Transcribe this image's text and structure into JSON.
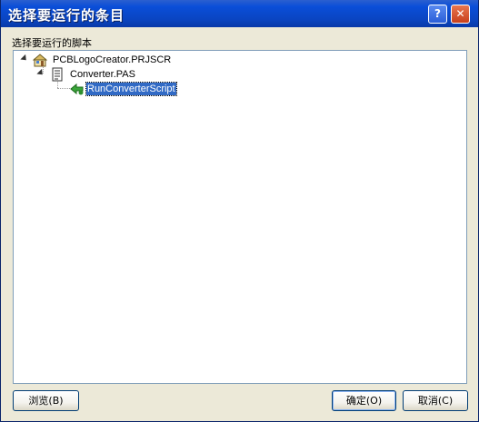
{
  "window": {
    "title": "选择要运行的条目",
    "help_button": "?",
    "close_button": "✕"
  },
  "section_label": "选择要运行的脚本",
  "tree": {
    "items": [
      {
        "label": "PCBLogoCreator.PRJSCR",
        "icon": "project-icon",
        "level": 0,
        "expanded": true
      },
      {
        "label": "Converter.PAS",
        "icon": "script-file-icon",
        "level": 1,
        "expanded": true
      },
      {
        "label": "RunConverterScript",
        "icon": "procedure-icon",
        "level": 2,
        "selected": true
      }
    ]
  },
  "buttons": {
    "browse": "浏览(B)",
    "ok": "确定(O)",
    "cancel": "取消(C)"
  },
  "colors": {
    "titlebar": "#0a45c2",
    "selection": "#316ac5",
    "dialog_bg": "#ece9d8",
    "tree_border": "#7f9db9"
  }
}
